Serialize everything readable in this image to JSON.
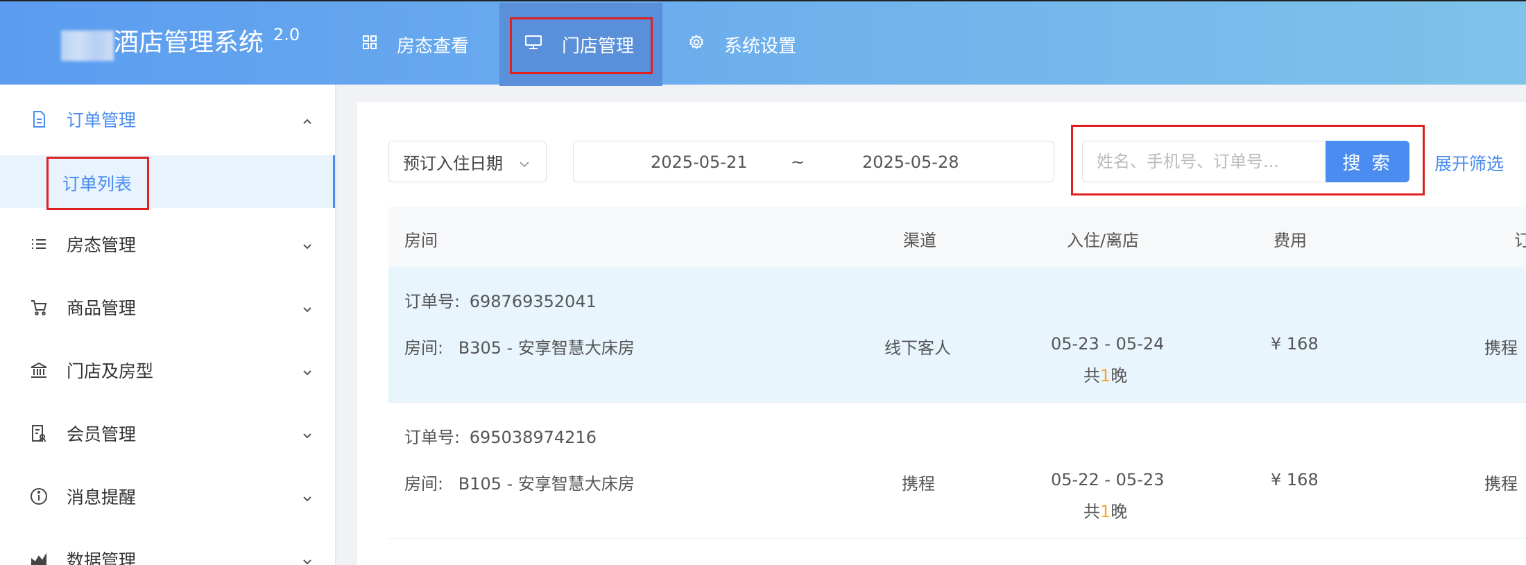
{
  "header": {
    "app_title": "酒店管理系统",
    "version": "2.0",
    "nav": [
      {
        "label": "房态查看",
        "icon": "grid-icon"
      },
      {
        "label": "门店管理",
        "icon": "monitor-icon"
      },
      {
        "label": "系统设置",
        "icon": "gear-icon"
      }
    ]
  },
  "sidebar": {
    "items": [
      {
        "label": "订单管理",
        "icon": "document-icon",
        "expanded": true
      },
      {
        "label": "房态管理",
        "icon": "list-icon"
      },
      {
        "label": "商品管理",
        "icon": "cart-icon"
      },
      {
        "label": "门店及房型",
        "icon": "bank-icon"
      },
      {
        "label": "会员管理",
        "icon": "member-card-icon"
      },
      {
        "label": "消息提醒",
        "icon": "info-icon"
      },
      {
        "label": "数据管理",
        "icon": "chart-icon"
      }
    ],
    "sub_items": [
      {
        "label": "订单列表",
        "active": true
      }
    ]
  },
  "filters": {
    "date_type": "预订入住日期",
    "date_from": "2025-05-21",
    "date_sep": "~",
    "date_to": "2025-05-28",
    "search_placeholder": "姓名、手机号、订单号...",
    "search_button": "搜 索",
    "expand_filter": "展开筛选"
  },
  "table": {
    "columns": [
      "房间",
      "渠道",
      "入住/离店",
      "费用",
      "订"
    ],
    "rows": [
      {
        "order_label": "订单号:",
        "order_no": "698769352041",
        "room_label": "房间:",
        "room": "B305 - 安享智慧大床房",
        "channel": "线下客人",
        "dates": "05-23 - 05-24",
        "nights_prefix": "共",
        "nights": "1",
        "nights_suffix": "晚",
        "fee": "¥ 168",
        "source": "携程"
      },
      {
        "order_label": "订单号:",
        "order_no": "695038974216",
        "room_label": "房间:",
        "room": "B105 - 安享智慧大床房",
        "channel": "携程",
        "dates": "05-22 - 05-23",
        "nights_prefix": "共",
        "nights": "1",
        "nights_suffix": "晚",
        "fee": "¥ 168",
        "source": "携程"
      }
    ]
  },
  "colors": {
    "accent": "#4a8cf0",
    "highlight_box": "#e02020",
    "nights_number": "#f5a623"
  }
}
